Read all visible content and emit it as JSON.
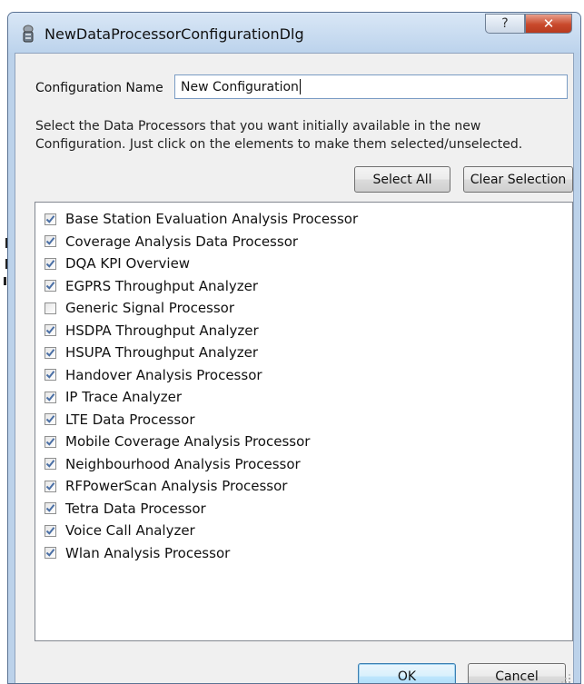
{
  "window": {
    "title": "NewDataProcessorConfigurationDlg",
    "help_label": "?",
    "close_label": "✕"
  },
  "config": {
    "label": "Configuration Name",
    "value": "New Configuration"
  },
  "description": {
    "line1": "Select the Data Processors that you want initially available in the new",
    "line2": "Configuration. Just click on the elements to make them selected/unselected."
  },
  "buttons": {
    "select_all": "Select All",
    "clear_selection": "Clear Selection",
    "ok": "OK",
    "cancel": "Cancel"
  },
  "processors": [
    {
      "label": "Base Station Evaluation Analysis Processor",
      "checked": true
    },
    {
      "label": "Coverage Analysis Data Processor",
      "checked": true
    },
    {
      "label": "DQA KPI Overview",
      "checked": true
    },
    {
      "label": "EGPRS Throughput Analyzer",
      "checked": true
    },
    {
      "label": "Generic Signal Processor",
      "checked": false
    },
    {
      "label": "HSDPA Throughput Analyzer",
      "checked": true
    },
    {
      "label": "HSUPA Throughput Analyzer",
      "checked": true
    },
    {
      "label": "Handover Analysis Processor",
      "checked": true
    },
    {
      "label": "IP Trace Analyzer",
      "checked": true
    },
    {
      "label": "LTE Data Processor",
      "checked": true
    },
    {
      "label": "Mobile Coverage Analysis Processor",
      "checked": true
    },
    {
      "label": "Neighbourhood Analysis Processor",
      "checked": true
    },
    {
      "label": "RFPowerScan Analysis Processor",
      "checked": true
    },
    {
      "label": "Tetra Data Processor",
      "checked": true
    },
    {
      "label": "Voice Call Analyzer",
      "checked": true
    },
    {
      "label": "Wlan Analysis Processor",
      "checked": true
    }
  ],
  "colors": {
    "check_mark": "#4a6fa5",
    "frame": "#bcd2ea",
    "close_button": "#c9492c"
  }
}
